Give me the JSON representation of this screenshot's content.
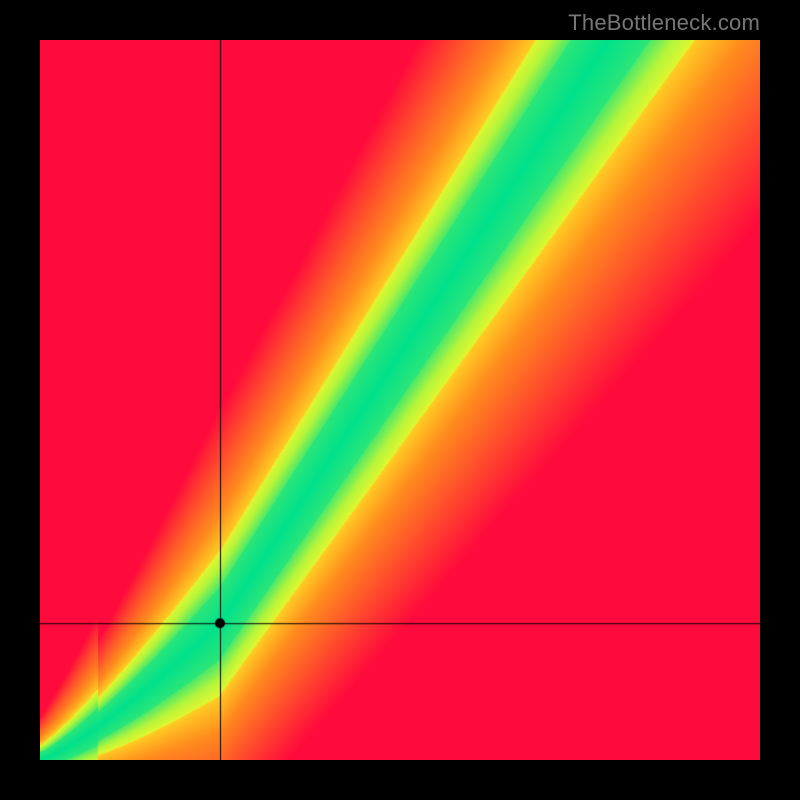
{
  "watermark": "TheBottleneck.com",
  "chart_data": {
    "type": "heatmap",
    "title": "",
    "xlabel": "",
    "ylabel": "",
    "xlim": [
      0,
      100
    ],
    "ylim": [
      0,
      100
    ],
    "crosshair": {
      "x": 25,
      "y": 19
    },
    "marker": {
      "x": 25,
      "y": 19
    },
    "optimal_curve_description": "Green optimal band runs from bottom-left corner to upper-right; below x≈25 it curves upward (y < x), then rises linearly with slope ≈1.5 toward the top edge.",
    "field": "Smooth gradient: red at far-from-optimal regions, through orange and yellow, to green along the optimal diagonal band.",
    "colors": {
      "cold_far": "#ff0033",
      "warm": "#ff9900",
      "near": "#ffff33",
      "optimal": "#00e68a"
    }
  }
}
